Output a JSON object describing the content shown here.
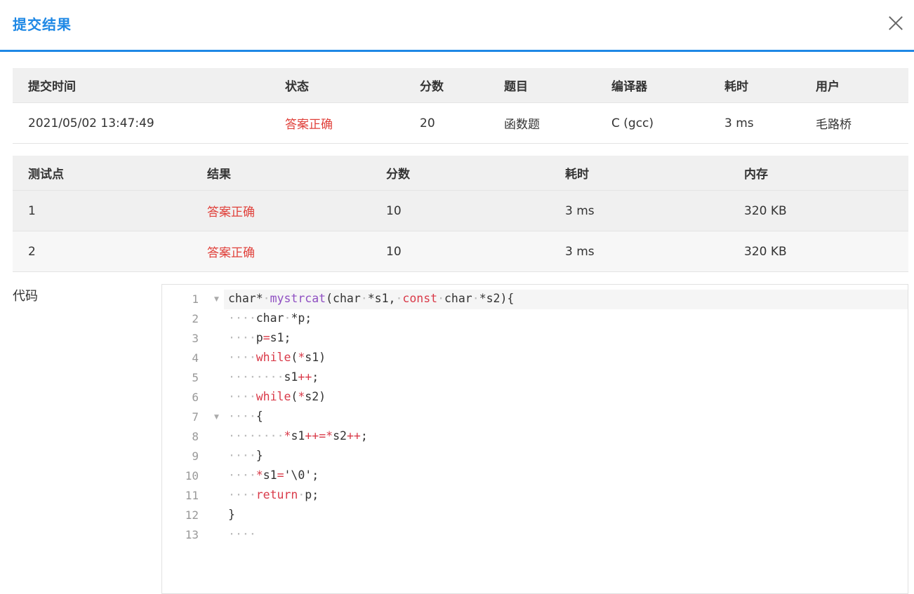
{
  "dialog": {
    "title": "提交结果",
    "close_icon": "close-icon"
  },
  "summary": {
    "headers": [
      "提交时间",
      "状态",
      "分数",
      "题目",
      "编译器",
      "耗时",
      "用户"
    ],
    "row": [
      "2021/05/02 13:47:49",
      "答案正确",
      "20",
      "函数题",
      "C (gcc)",
      "3 ms",
      "毛路桥"
    ]
  },
  "cases": {
    "headers": [
      "测试点",
      "结果",
      "分数",
      "耗时",
      "内存"
    ],
    "rows": [
      [
        "1",
        "答案正确",
        "10",
        "3 ms",
        "320 KB"
      ],
      [
        "2",
        "答案正确",
        "10",
        "3 ms",
        "320 KB"
      ]
    ]
  },
  "code": {
    "label": "代码",
    "lines": [
      "char*·mystrcat(char·*s1,·const·char·*s2){",
      "····char·*p;",
      "····p=s1;",
      "····while(*s1)",
      "········s1++;",
      "····while(*s2)",
      "····{",
      "········*s1++=*s2++;",
      "····}",
      "····*s1='\\0';",
      "····return·p;",
      "}",
      "····"
    ]
  },
  "colors": {
    "accent": "#1e88e5",
    "success": "#e0403a"
  }
}
